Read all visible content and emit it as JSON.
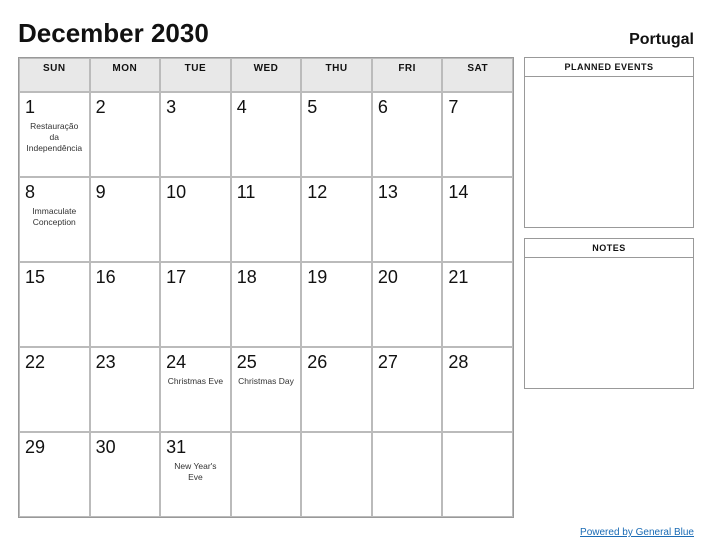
{
  "header": {
    "title": "December 2030",
    "country": "Portugal"
  },
  "calendar": {
    "day_headers": [
      "SUN",
      "MON",
      "TUE",
      "WED",
      "THU",
      "FRI",
      "SAT"
    ],
    "weeks": [
      [
        {
          "day": "1",
          "event": "Restauração\nda\nIndependência"
        },
        {
          "day": "2",
          "event": ""
        },
        {
          "day": "3",
          "event": ""
        },
        {
          "day": "4",
          "event": ""
        },
        {
          "day": "5",
          "event": ""
        },
        {
          "day": "6",
          "event": ""
        },
        {
          "day": "7",
          "event": ""
        }
      ],
      [
        {
          "day": "8",
          "event": "Immaculate\nConception"
        },
        {
          "day": "9",
          "event": ""
        },
        {
          "day": "10",
          "event": ""
        },
        {
          "day": "11",
          "event": ""
        },
        {
          "day": "12",
          "event": ""
        },
        {
          "day": "13",
          "event": ""
        },
        {
          "day": "14",
          "event": ""
        }
      ],
      [
        {
          "day": "15",
          "event": ""
        },
        {
          "day": "16",
          "event": ""
        },
        {
          "day": "17",
          "event": ""
        },
        {
          "day": "18",
          "event": ""
        },
        {
          "day": "19",
          "event": ""
        },
        {
          "day": "20",
          "event": ""
        },
        {
          "day": "21",
          "event": ""
        }
      ],
      [
        {
          "day": "22",
          "event": ""
        },
        {
          "day": "23",
          "event": ""
        },
        {
          "day": "24",
          "event": "Christmas Eve"
        },
        {
          "day": "25",
          "event": "Christmas Day"
        },
        {
          "day": "26",
          "event": ""
        },
        {
          "day": "27",
          "event": ""
        },
        {
          "day": "28",
          "event": ""
        }
      ],
      [
        {
          "day": "29",
          "event": ""
        },
        {
          "day": "30",
          "event": ""
        },
        {
          "day": "31",
          "event": "New Year's\nEve"
        },
        {
          "day": "",
          "event": ""
        },
        {
          "day": "",
          "event": ""
        },
        {
          "day": "",
          "event": ""
        },
        {
          "day": "",
          "event": ""
        }
      ]
    ]
  },
  "sidebar": {
    "planned_events_label": "PLANNED EVENTS",
    "notes_label": "NOTES"
  },
  "footer": {
    "link_text": "Powered by General Blue"
  }
}
